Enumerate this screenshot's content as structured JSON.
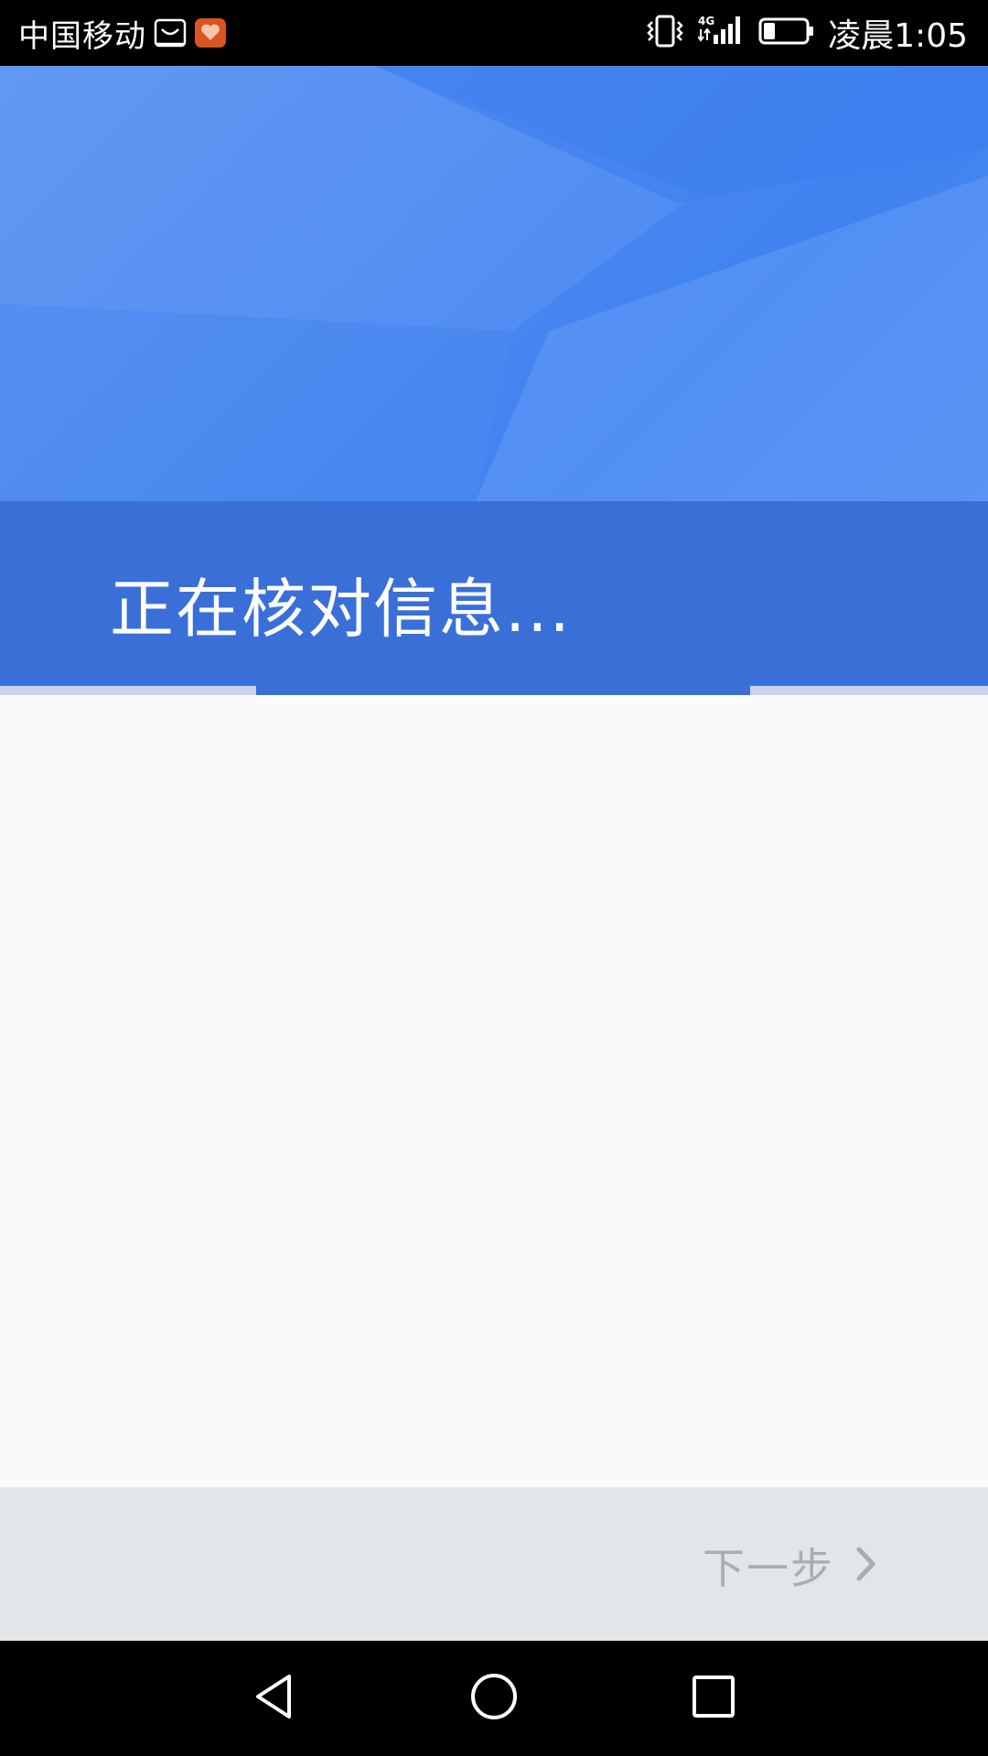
{
  "status_bar": {
    "carrier": "中国移动",
    "clock": "凌晨1:05",
    "notification_icons": [
      "shopping-bag-icon",
      "heart-app-icon"
    ],
    "system_icons": [
      "vibrate-icon",
      "signal-4g-icon",
      "battery-icon"
    ],
    "network_label": "4G"
  },
  "header": {
    "title": "正在核对信息...",
    "progress": 0.5,
    "colors": {
      "band": "#3a6fd8",
      "gradient_light": "#5d95f2",
      "gradient_dark": "#3f82f0"
    }
  },
  "footer": {
    "next_label": "下一步"
  },
  "nav_bar": {
    "buttons": [
      "back-icon",
      "home-icon",
      "recents-icon"
    ]
  }
}
